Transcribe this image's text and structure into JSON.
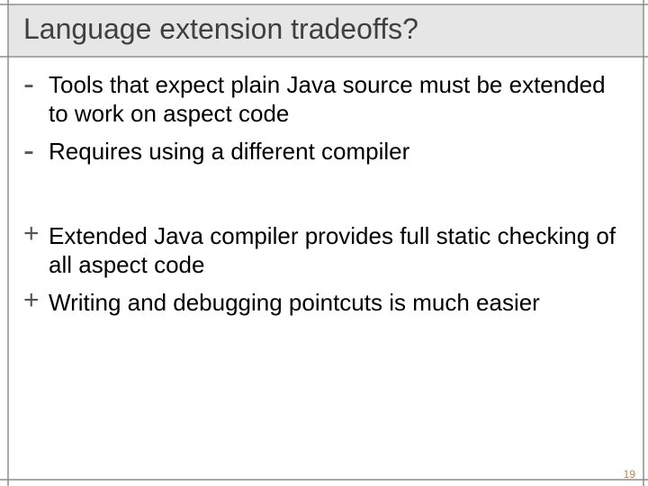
{
  "slide": {
    "title": "Language extension tradeoffs?",
    "items": [
      {
        "bullet": "-",
        "kind": "minus",
        "text": "Tools that expect plain Java source must be extended to work on aspect code"
      },
      {
        "bullet": "-",
        "kind": "minus",
        "text": "Requires using a different compiler"
      },
      {
        "bullet": "+",
        "kind": "plus",
        "text": "Extended Java compiler provides full static checking of all aspect code"
      },
      {
        "bullet": "+",
        "kind": "plus",
        "text": "Writing and debugging pointcuts is much easier"
      }
    ],
    "page_number": "19"
  }
}
